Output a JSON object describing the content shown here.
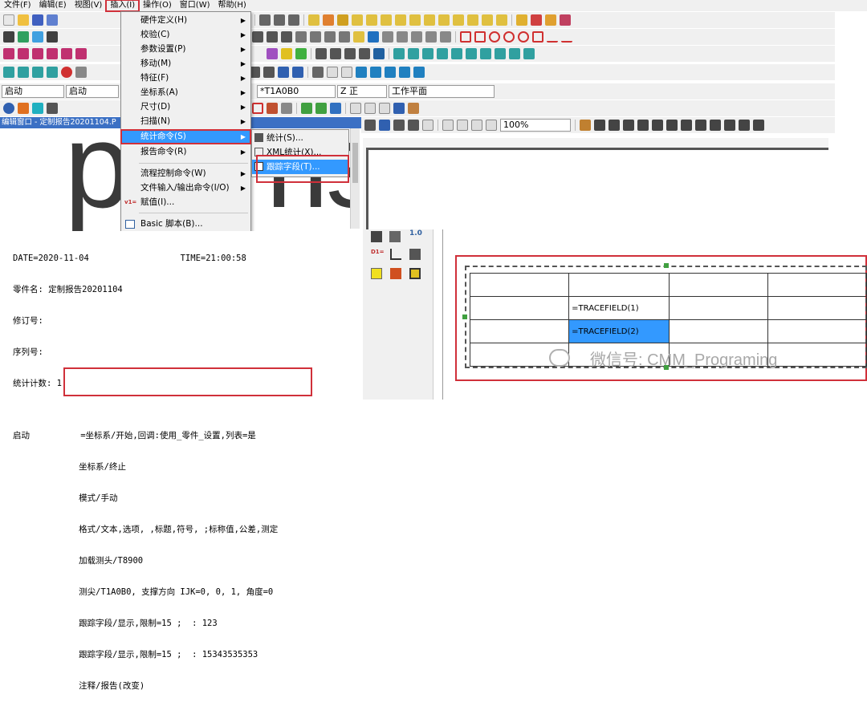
{
  "menubar": {
    "items": [
      "文件(F)",
      "编辑(E)",
      "视图(V)",
      "插入(I)",
      "操作(O)",
      "窗口(W)",
      "帮助(H)"
    ]
  },
  "combos": {
    "start1": "启动",
    "start2": "启动",
    "probe": "*T1A0B0",
    "plane": "Z 正",
    "workplane": "工作平面",
    "zoom": "100%"
  },
  "editor": {
    "title": "编辑窗口 - 定制报告20201104.P",
    "watermark_text": "perms"
  },
  "insert_menu": {
    "items": [
      "硬件定义(H)",
      "校验(C)",
      "参数设置(P)",
      "移动(M)",
      "特征(F)",
      "坐标系(A)",
      "尺寸(D)",
      "扫描(N)",
      "统计命令(S)",
      "报告命令(R)",
      "流程控制命令(W)",
      "文件输入/输出命令(I/O)",
      "赋值(I)...",
      "Basic 脚本(B)..."
    ]
  },
  "stats_submenu": {
    "items": [
      "统计(S)...",
      "XML统计(X)...",
      "跟踪字段(T)..."
    ]
  },
  "report_text": {
    "date_line": "DATE=2020-11-04                  TIME=21:00:58",
    "part_name": "零件名: 定制报告20201104",
    "rev": "修订号:",
    "serial": "序列号:",
    "stat_count": "统计计数: 1",
    "blank": "",
    "l1": "启动          =坐标系/开始,回调:使用_零件_设置,列表=是",
    "l2": "             坐标系/终止",
    "l3": "             模式/手动",
    "l4": "             格式/文本,选项, ,标题,符号, ;标称值,公差,测定",
    "l5": "             加载测头/T8900",
    "l6": "             测尖/T1A0B0, 支撑方向 IJK=0, 0, 1, 角度=0",
    "l7": "             跟踪字段/显示,限制=15 ;  : 123",
    "l8": "             跟踪字段/显示,限制=15 ;  : 15343535353",
    "l9": "             注释/报告(改变)"
  },
  "report_table": {
    "cell_tf1": "=TRACEFIELD(1)",
    "cell_tf2": "=TRACEFIELD(2)"
  },
  "wechat_watermark": "微信号: CMM_Programing",
  "colors": {
    "highlight": "#3399ff",
    "annotation_red": "#d0303a",
    "toolbar_bg": "#f0f0f0"
  }
}
